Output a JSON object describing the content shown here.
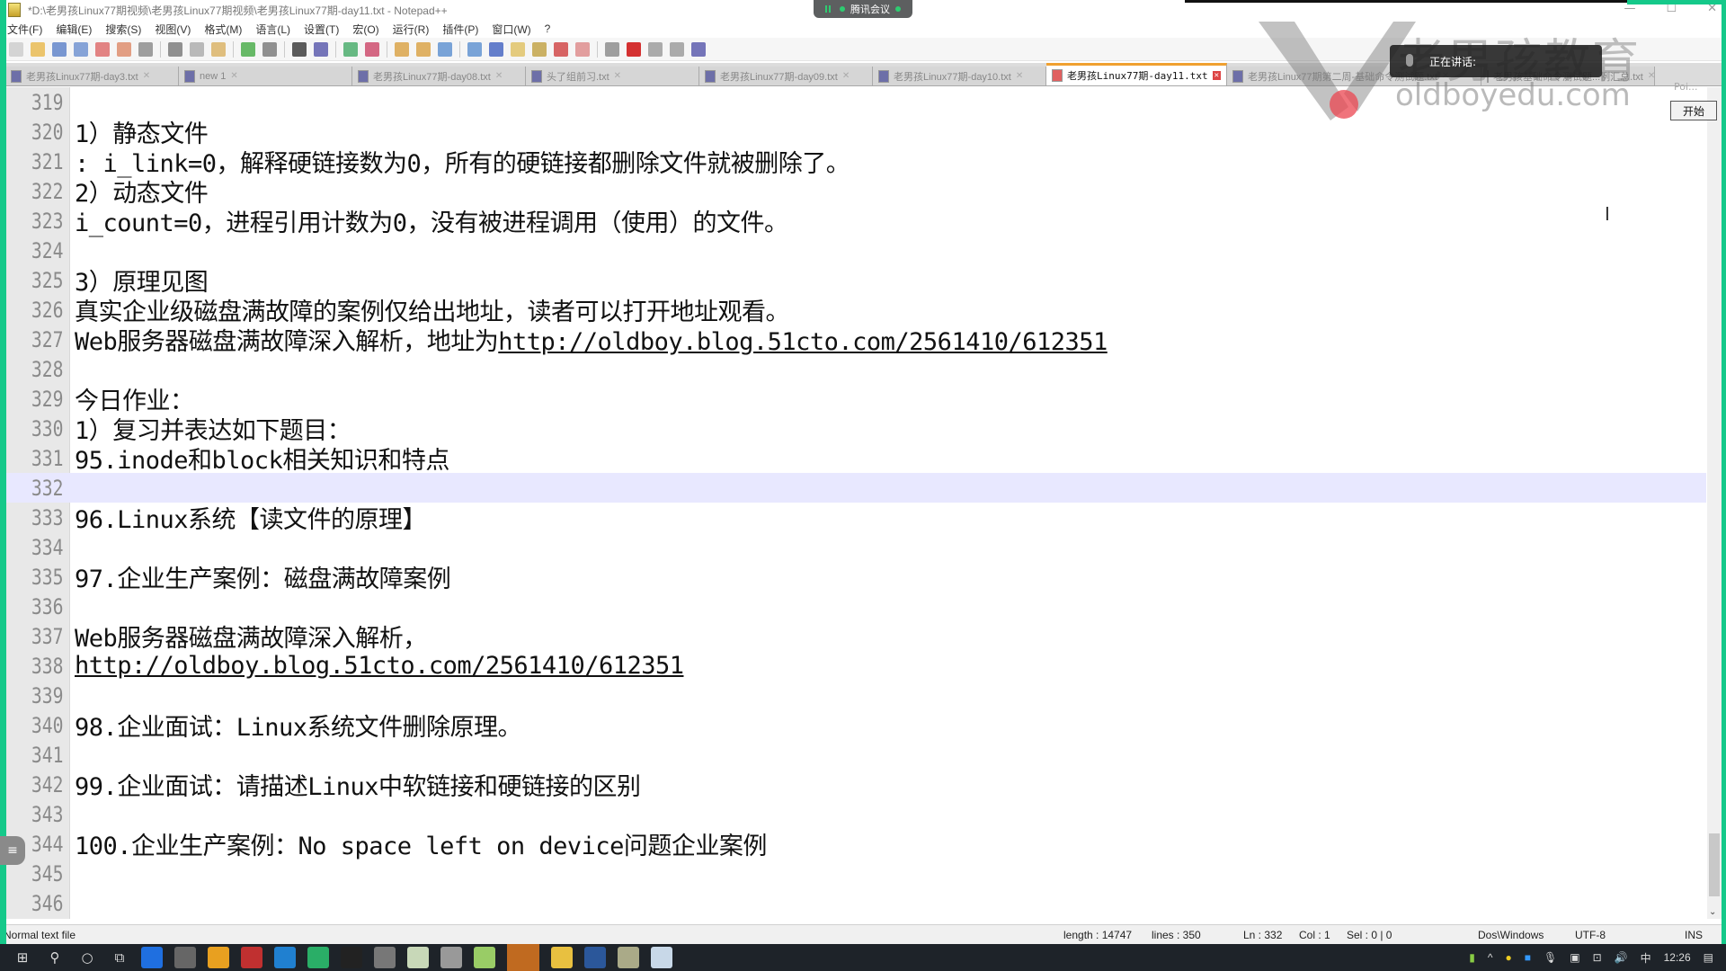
{
  "window": {
    "title": "*D:\\老男孩Linux77期视频\\老男孩Linux77期视频\\老男孩Linux77期-day11.txt - Notepad++",
    "controls": [
      "—",
      "☐",
      "✕"
    ]
  },
  "meeting": {
    "label": "腾讯会议",
    "speaking_label": "正在讲话:",
    "start_button": "开始",
    "poi_label": "Poi..."
  },
  "watermark": {
    "cn": "老男孩教育",
    "en": "oldboyedu.com"
  },
  "menu": [
    "文件(F)",
    "编辑(E)",
    "搜索(S)",
    "视图(V)",
    "格式(M)",
    "语言(L)",
    "设置(T)",
    "宏(O)",
    "运行(R)",
    "插件(P)",
    "窗口(W)",
    "?"
  ],
  "toolbar": [
    "new-file",
    "open-file",
    "save",
    "save-all",
    "close",
    "close-all",
    "print",
    "cut",
    "copy",
    "paste",
    "undo",
    "redo",
    "find",
    "replace",
    "zoom-in",
    "zoom-out",
    "sync-v",
    "sync-h",
    "word-wrap",
    "show-all-chars",
    "indent-guide",
    "doc-map",
    "function-list",
    "folder-workspace",
    "monitor",
    "record-macro",
    "stop-macro",
    "play-macro",
    "run-macro-multiple",
    "save-macro"
  ],
  "tabs": [
    {
      "label": "老男孩Linux77期-day3.txt",
      "active": false
    },
    {
      "label": "new 1",
      "active": false
    },
    {
      "label": "老男孩Linux77期-day08.txt",
      "active": false
    },
    {
      "label": "头了组前习.txt",
      "active": false
    },
    {
      "label": "老男孩Linux77期-day09.txt",
      "active": false
    },
    {
      "label": "老男孩Linux77期-day10.txt",
      "active": false
    },
    {
      "label": "老男孩Linux77期-day11.txt",
      "active": true
    },
    {
      "label": "老男孩Linux77期第二周-基础命令测试题.txt",
      "active": false
    },
    {
      "label": "老男孩基础命令测试题...例汇总.txt",
      "active": false
    }
  ],
  "editor": {
    "current_line": 332,
    "lines": [
      {
        "n": "319",
        "t": ""
      },
      {
        "n": "320",
        "t": "1）静态文件"
      },
      {
        "n": "321",
        "t": ": i_link=0，解释硬链接数为0，所有的硬链接都删除文件就被删除了。"
      },
      {
        "n": "322",
        "t": "2）动态文件"
      },
      {
        "n": "323",
        "t": "i_count=0，进程引用计数为0，没有被进程调用（使用）的文件。"
      },
      {
        "n": "324",
        "t": ""
      },
      {
        "n": "325",
        "t": "3）原理见图"
      },
      {
        "n": "326",
        "t": "真实企业级磁盘满故障的案例仅给出地址，读者可以打开地址观看。"
      },
      {
        "n": "327",
        "t": "Web服务器磁盘满故障深入解析，地址为",
        "link": "http://oldboy.blog.51cto.com/2561410/612351"
      },
      {
        "n": "328",
        "t": ""
      },
      {
        "n": "329",
        "t": "今日作业："
      },
      {
        "n": "330",
        "t": "1）复习并表达如下题目："
      },
      {
        "n": "331",
        "t": "95.inode和block相关知识和特点"
      },
      {
        "n": "332",
        "t": ""
      },
      {
        "n": "333",
        "t": "96.Linux系统【读文件的原理】"
      },
      {
        "n": "334",
        "t": ""
      },
      {
        "n": "335",
        "t": "97.企业生产案例：磁盘满故障案例"
      },
      {
        "n": "336",
        "t": ""
      },
      {
        "n": "337",
        "t": "Web服务器磁盘满故障深入解析，"
      },
      {
        "n": "338",
        "t": "",
        "link": "http://oldboy.blog.51cto.com/2561410/612351"
      },
      {
        "n": "339",
        "t": ""
      },
      {
        "n": "340",
        "t": "98.企业面试：Linux系统文件删除原理。"
      },
      {
        "n": "341",
        "t": ""
      },
      {
        "n": "342",
        "t": "99.企业面试：请描述Linux中软链接和硬链接的区别"
      },
      {
        "n": "343",
        "t": ""
      },
      {
        "n": "344",
        "t": "100.企业生产案例：No space left on device问题企业案例"
      },
      {
        "n": "345",
        "t": ""
      },
      {
        "n": "346",
        "t": ""
      }
    ]
  },
  "statusbar": {
    "file_type": "Normal text file",
    "length": "length : 14747",
    "lines": "lines : 350",
    "ln": "Ln : 332",
    "col": "Col : 1",
    "sel": "Sel : 0 | 0",
    "eol": "Dos\\Windows",
    "encoding": "UTF-8",
    "mode": "INS"
  },
  "taskbar": {
    "apps": [
      "start",
      "search",
      "cortana",
      "task-view",
      "app-blue-m",
      "app-tool",
      "chrome",
      "app-red",
      "app-sync",
      "wechat",
      "qq",
      "app-remote",
      "app-image",
      "app-disk",
      "notepad-plus-plus",
      "app-oldboy",
      "file-explorer",
      "word",
      "app-bug",
      "app-paint"
    ],
    "tray": {
      "ime": "中",
      "time": "12:26"
    }
  },
  "colors": {
    "accent_green": "#15c98a",
    "current_line": "#e8e8ff",
    "active_tab_top": "#f0a030"
  }
}
